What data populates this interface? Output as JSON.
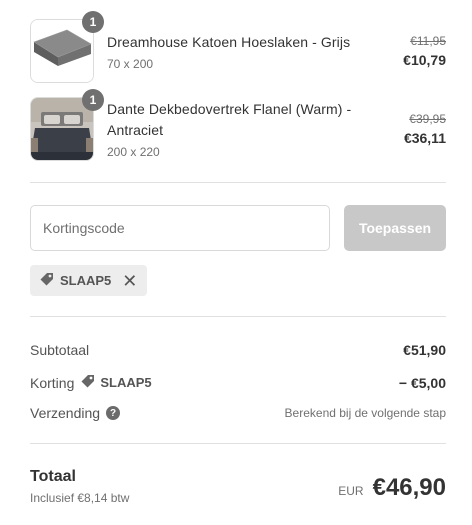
{
  "cart": {
    "items": [
      {
        "quantity": "1",
        "title": "Dreamhouse Katoen Hoeslaken - Grijs",
        "variant": "70 x 200",
        "price_old": "€11,95",
        "price_new": "€10,79"
      },
      {
        "quantity": "1",
        "title": "Dante Dekbedovertrek Flanel (Warm) - Antraciet",
        "variant": "200 x 220",
        "price_old": "€39,95",
        "price_new": "€36,11"
      }
    ]
  },
  "discount": {
    "placeholder": "Kortingscode",
    "value": "",
    "apply_label": "Toepassen",
    "applied_code": "SLAAP5"
  },
  "summary": {
    "subtotal_label": "Subtotaal",
    "subtotal_value": "€51,90",
    "discount_label": "Korting",
    "discount_code": "SLAAP5",
    "discount_value": "− €5,00",
    "shipping_label": "Verzending",
    "shipping_value": "Berekend bij de volgende stap"
  },
  "total": {
    "label": "Totaal",
    "tax_note": "Inclusief €8,14 btw",
    "currency": "EUR",
    "amount": "€46,90"
  },
  "colors": {
    "apply_button_disabled": "#c8c8c8",
    "quantity_badge": "#707070",
    "chip_background": "#ededed"
  }
}
